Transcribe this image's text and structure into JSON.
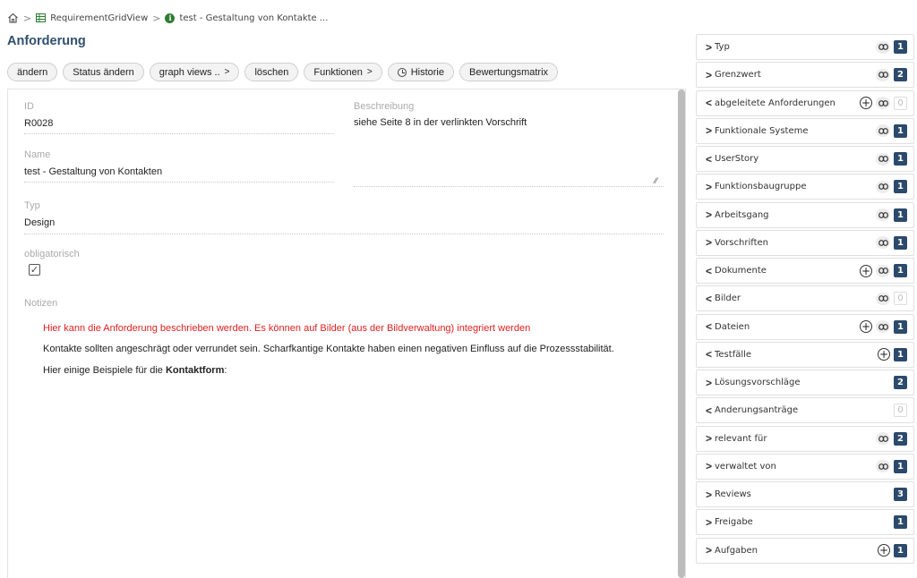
{
  "breadcrumb": {
    "items": [
      {
        "icon": "home-icon",
        "label": ""
      },
      {
        "icon": "grid-icon",
        "label": "RequirementGridView"
      },
      {
        "icon": "info-icon",
        "label": "test - Gestaltung von Kontakte ..."
      }
    ],
    "separator": ">"
  },
  "page": {
    "title": "Anforderung"
  },
  "toolbar": {
    "buttons": [
      {
        "label": "ändern"
      },
      {
        "label": "Status ändern"
      },
      {
        "label": "graph views ..",
        "suffix": ">"
      },
      {
        "label": "löschen"
      },
      {
        "label": "Funktionen",
        "suffix": ">"
      },
      {
        "label": "Historie",
        "icon": "clock-icon"
      },
      {
        "label": "Bewertungsmatrix"
      }
    ]
  },
  "form": {
    "id_label": "ID",
    "id_value": "R0028",
    "beschreibung_label": "Beschreibung",
    "beschreibung_value": "siehe Seite 8 in der verlinkten Vorschrift",
    "name_label": "Name",
    "name_value": "test - Gestaltung von Kontakten",
    "typ_label": "Typ",
    "typ_value": "Design",
    "obligatorisch_label": "obligatorisch",
    "obligatorisch_checked": true,
    "notizen_label": "Notizen",
    "notes": {
      "line1": "Hier kann die Anforderung beschrieben werden. Es können auf Bilder (aus der Bildverwaltung) integriert werden",
      "line2": "Kontakte sollten angeschrägt oder verrundet sein. Scharfkantige Kontakte haben einen negativen Einfluss auf die Prozessstabilität.",
      "line3_prefix": "Hier einige Beispiele für die ",
      "line3_bold": "Kontaktform",
      "line3_suffix": ":"
    }
  },
  "relations": [
    {
      "label": "Typ",
      "chevron": ">",
      "add": false,
      "link": true,
      "count": "1"
    },
    {
      "label": "Grenzwert",
      "chevron": ">",
      "add": false,
      "link": true,
      "count": "2"
    },
    {
      "label": "abgeleitete Anforderungen",
      "chevron": "<",
      "add": true,
      "link": true,
      "count": "0"
    },
    {
      "label": "Funktionale Systeme",
      "chevron": ">",
      "add": false,
      "link": true,
      "count": "1"
    },
    {
      "label": "UserStory",
      "chevron": "<",
      "add": false,
      "link": true,
      "count": "1"
    },
    {
      "label": "Funktionsbaugruppe",
      "chevron": ">",
      "add": false,
      "link": true,
      "count": "1"
    },
    {
      "label": "Arbeitsgang",
      "chevron": ">",
      "add": false,
      "link": true,
      "count": "1"
    },
    {
      "label": "Vorschriften",
      "chevron": ">",
      "add": false,
      "link": true,
      "count": "1"
    },
    {
      "label": "Dokumente",
      "chevron": "<",
      "add": true,
      "link": true,
      "count": "1"
    },
    {
      "label": "Bilder",
      "chevron": "<",
      "add": false,
      "link": true,
      "count": "0"
    },
    {
      "label": "Dateien",
      "chevron": "<",
      "add": true,
      "link": true,
      "count": "1"
    },
    {
      "label": "Testfälle",
      "chevron": "<",
      "add": true,
      "link": false,
      "count": "1"
    },
    {
      "label": "Lösungsvorschläge",
      "chevron": ">",
      "add": false,
      "link": false,
      "count": "2"
    },
    {
      "label": "Änderungsanträge",
      "chevron": "<",
      "add": false,
      "link": false,
      "count": "0"
    },
    {
      "label": "relevant für",
      "chevron": ">",
      "add": false,
      "link": true,
      "count": "2"
    },
    {
      "label": "verwaltet von",
      "chevron": ">",
      "add": false,
      "link": true,
      "count": "1"
    },
    {
      "label": "Reviews",
      "chevron": ">",
      "add": false,
      "link": false,
      "count": "3"
    },
    {
      "label": "Freigabe",
      "chevron": ">",
      "add": false,
      "link": false,
      "count": "1"
    },
    {
      "label": "Aufgaben",
      "chevron": ">",
      "add": true,
      "link": false,
      "count": "1"
    }
  ],
  "colors": {
    "title": "#2f4f6e",
    "badge": "#2c4a6b",
    "note_highlight": "#e02020"
  }
}
